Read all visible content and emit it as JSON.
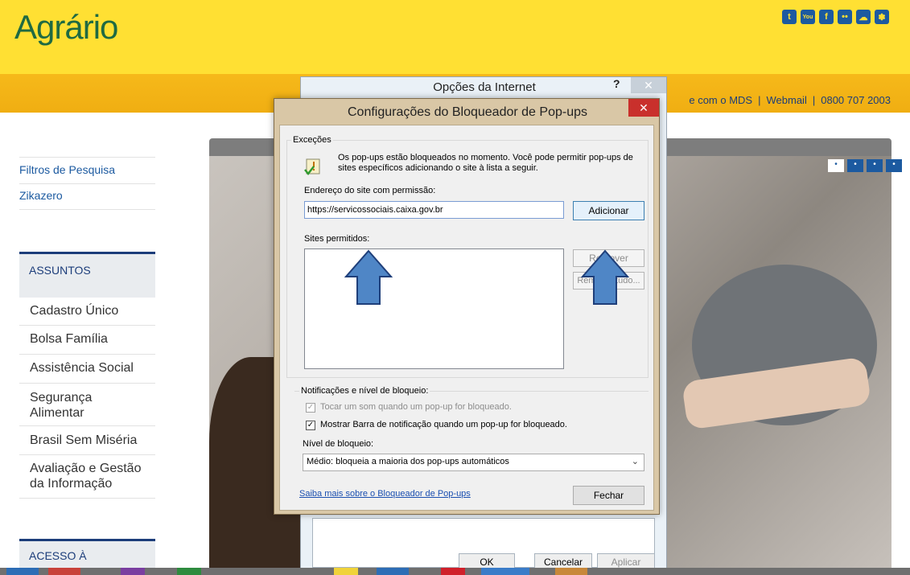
{
  "site": {
    "logo": "Agrário",
    "social_icons": [
      "twitter-icon",
      "youtube-icon",
      "facebook-icon",
      "flickr-icon",
      "cloud-icon",
      "other-icon"
    ],
    "social_glyphs": [
      "t",
      "You",
      "f",
      "••",
      "☁",
      "✽"
    ],
    "top_links": [
      "e com o MDS",
      "Webmail",
      "0800 707 2003"
    ]
  },
  "sidebar": {
    "links": [
      "Filtros de Pesquisa",
      "Zikazero"
    ],
    "section_title": "ASSUNTOS",
    "subjects": [
      "Cadastro Único",
      "Bolsa Família",
      "Assistência Social",
      "Segurança Alimentar",
      "Brasil Sem Miséria",
      "Avaliação e Gestão da Informação"
    ],
    "bottom_section": "ACESSO À"
  },
  "carousel": {
    "dots": [
      "•",
      "•",
      "•",
      "•"
    ]
  },
  "back_dialog": {
    "title": "Opções da Internet",
    "help": "?",
    "close": "✕",
    "buttons": [
      "OK",
      "Cancelar",
      "Aplicar"
    ]
  },
  "dialog": {
    "title": "Configurações do Bloqueador de Pop-ups",
    "close": "✕",
    "exceptions_label": "Exceções",
    "info": "Os pop-ups estão bloqueados no momento. Você pode permitir pop-ups de sites específicos adicionando o site à lista a seguir.",
    "address_label": "Endereço do site com permissão:",
    "address_value": "https://servicossociais.caixa.gov.br",
    "add_button": "Adicionar",
    "sites_label": "Sites permitidos:",
    "remove_button": "Remover",
    "remove_all_button": "Remover tudo...",
    "notifications_label": "Notificações e nível de bloqueio:",
    "sound_option": "Tocar um som quando um pop-up for bloqueado.",
    "bar_option": "Mostrar Barra de notificação quando um pop-up for bloqueado.",
    "level_label": "Nível de bloqueio:",
    "level_value": "Médio: bloqueia a maioria dos pop-ups automáticos",
    "learn_link": "Saiba mais sobre o Bloqueador de Pop-ups",
    "close_button": "Fechar"
  },
  "colors": {
    "header_yellow": "#ffe033",
    "bar_orange": "#f0ae12",
    "logo_green": "#1f6a42",
    "navy": "#1c3d7a",
    "arrow_blue": "#4f86c6"
  }
}
